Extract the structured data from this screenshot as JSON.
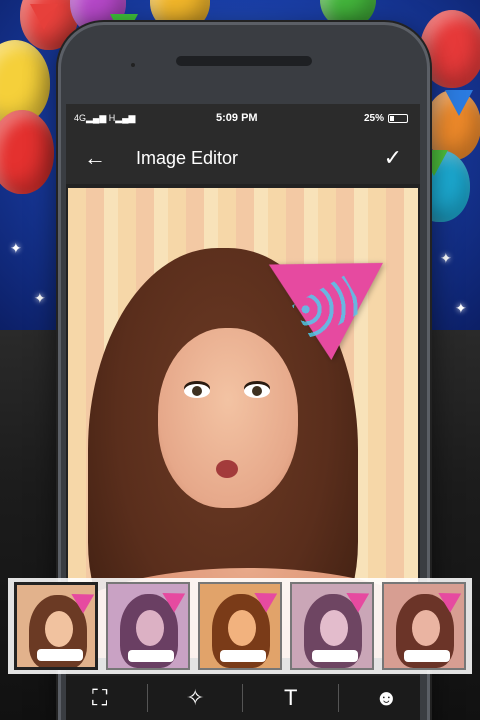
{
  "status_bar": {
    "network": "4G",
    "signal": "H",
    "time": "5:09 PM",
    "volte": "VoLTE",
    "battery": "25%"
  },
  "toolbar": {
    "title": "Image Editor",
    "back_icon": "arrow-left-icon",
    "done_icon": "checkmark-icon"
  },
  "filters": [
    {
      "label": "",
      "tint": "#e2b28c",
      "hair": "#6b3a24",
      "face": "#f1c29f"
    },
    {
      "label": "",
      "tint": "#c9a2c4",
      "hair": "#6a3f63",
      "face": "#dcb1c4"
    },
    {
      "label": "",
      "tint": "#e1a36a",
      "hair": "#7a3b18",
      "face": "#f2b27e"
    },
    {
      "label": "",
      "tint": "#caa6b7",
      "hair": "#6e4562",
      "face": "#e3bccc"
    },
    {
      "label": "",
      "tint": "#d79e92",
      "hair": "#6b3428",
      "face": "#eab4a2"
    }
  ],
  "tools": [
    {
      "icon": "crop-icon",
      "glyph": "⛶"
    },
    {
      "icon": "magic-wand-icon",
      "glyph": "✧"
    },
    {
      "icon": "text-icon",
      "glyph": "T"
    },
    {
      "icon": "sticker-icon",
      "glyph": "☻"
    }
  ],
  "colors": {
    "background": "#1a3fa8",
    "toolbar": "#2b2b2b",
    "accent": "#e64aa0"
  }
}
